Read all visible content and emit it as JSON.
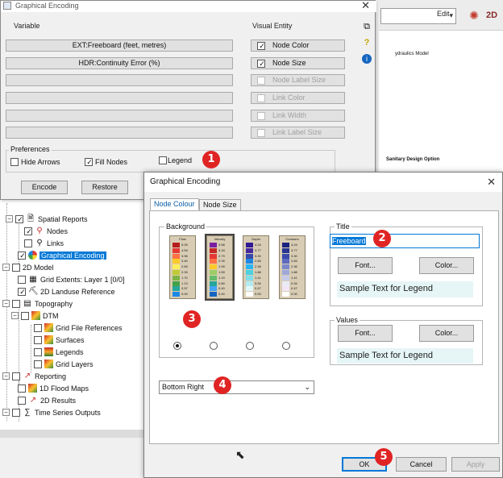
{
  "bg_app": {
    "edit_label": "Edit",
    "canvas_text_1": "ydraulics Model",
    "canvas_text_2": "Sanitary Design Option",
    "tree": [
      {
        "label": "Spatial Reports",
        "level": 1
      },
      {
        "label": "Nodes",
        "level": 2
      },
      {
        "label": "Links",
        "level": 2
      },
      {
        "label": "Graphical Encoding",
        "level": 1
      },
      {
        "label": "2D Model",
        "level": 0
      },
      {
        "label": "Grid Extents: Layer 1 [0/0]",
        "level": 1
      },
      {
        "label": "2D Landuse Reference",
        "level": 1
      },
      {
        "label": "Topography",
        "level": 0
      },
      {
        "label": "DTM",
        "level": 1
      },
      {
        "label": "Grid File References",
        "level": 2
      },
      {
        "label": "Surfaces",
        "level": 2
      },
      {
        "label": "Legends",
        "level": 2
      },
      {
        "label": "Grid Layers",
        "level": 2
      },
      {
        "label": "Reporting",
        "level": 0
      },
      {
        "label": "1D Flood Maps",
        "level": 1
      },
      {
        "label": "2D Results",
        "level": 1
      },
      {
        "label": "Time Series Outputs",
        "level": 1
      }
    ]
  },
  "dialog1": {
    "title": "Graphical Encoding",
    "variable_header": "Variable",
    "visual_header": "Visual Entity",
    "variables": [
      "EXT:Freeboard (feet, metres)",
      "HDR:Continuity Error (%)",
      "",
      "",
      "",
      ""
    ],
    "visual_entities": [
      {
        "label": "Node Color",
        "checked": true,
        "enabled": true
      },
      {
        "label": "Node Size",
        "checked": true,
        "enabled": true
      },
      {
        "label": "Node Label Size",
        "checked": false,
        "enabled": false
      },
      {
        "label": "Link Color",
        "checked": false,
        "enabled": false
      },
      {
        "label": "Link Width",
        "checked": false,
        "enabled": false
      },
      {
        "label": "Link Label Size",
        "checked": false,
        "enabled": false
      }
    ],
    "preferences_title": "Preferences",
    "hide_arrows": "Hide Arrows",
    "fill_nodes": "Fill Nodes",
    "legend": "Legend",
    "encode_btn": "Encode",
    "restore_btn": "Restore"
  },
  "dialog2": {
    "title": "Graphical Encoding",
    "tabs": [
      "Node Colour",
      "Node Size"
    ],
    "background_title": "Background",
    "legends": [
      {
        "title": "Flow",
        "values": [
          "5.09",
          "4.53",
          "3.96",
          "3.40",
          "2.83",
          "2.26",
          "1.70",
          "1.13",
          "0.57",
          "0.00"
        ]
      },
      {
        "title": "Velocity",
        "values": [
          "3.58",
          "3.18",
          "2.79",
          "2.39",
          "1.99",
          "1.59",
          "1.19",
          "0.80",
          "0.40",
          "0.00"
        ]
      },
      {
        "title": "Depth",
        "values": [
          "4.24",
          "3.77",
          "3.30",
          "2.83",
          "2.36",
          "1.88",
          "1.41",
          "0.94",
          "0.47",
          "0.00"
        ]
      },
      {
        "title": "Contours",
        "values": [
          "4.24",
          "3.77",
          "3.30",
          "2.83",
          "2.36",
          "1.88",
          "1.41",
          "0.94",
          "0.47",
          "0.00"
        ]
      }
    ],
    "position_value": "Bottom Right",
    "title_group": "Title",
    "title_value": "Freeboard",
    "font_btn": "Font...",
    "color_btn": "Color...",
    "sample_text": "Sample Text for Legend",
    "values_group": "Values",
    "ok_btn": "OK",
    "cancel_btn": "Cancel",
    "apply_btn": "Apply"
  },
  "badges": [
    "1",
    "2",
    "3",
    "4",
    "5"
  ],
  "colors": {
    "accent": "#0078d7",
    "badge": "#e02424",
    "sample_bg": "#e6f5f6"
  }
}
